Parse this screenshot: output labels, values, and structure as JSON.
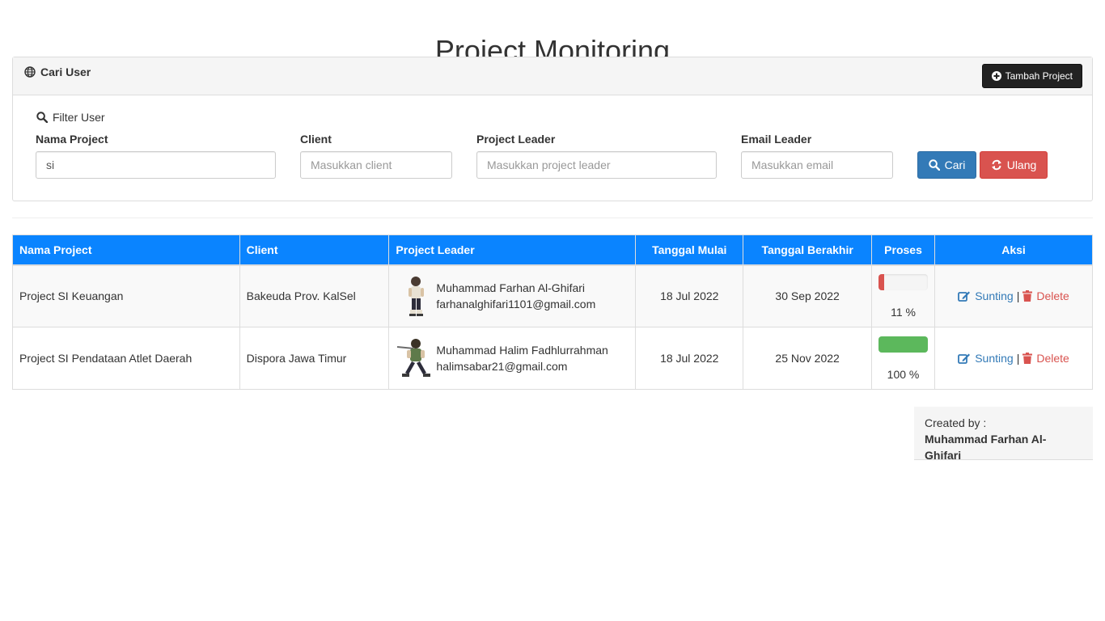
{
  "page": {
    "title": "Project Monitoring"
  },
  "panel": {
    "title": "Cari User",
    "title_icon": "globe-icon",
    "add_button": "Tambah Project",
    "add_button_icon": "plus-circle-icon"
  },
  "filter": {
    "label": "Filter User",
    "label_icon": "search-icon",
    "fields": [
      {
        "label": "Nama Project",
        "value": "si",
        "placeholder": ""
      },
      {
        "label": "Client",
        "value": "",
        "placeholder": "Masukkan client"
      },
      {
        "label": "Project Leader",
        "value": "",
        "placeholder": "Masukkan project leader"
      },
      {
        "label": "Email Leader",
        "value": "",
        "placeholder": "Masukkan email"
      }
    ],
    "search_button": "Cari",
    "reset_button": "Ulang"
  },
  "table": {
    "headers": [
      "Nama Project",
      "Client",
      "Project Leader",
      "Tanggal Mulai",
      "Tanggal Berakhir",
      "Proses",
      "Aksi"
    ],
    "rows": [
      {
        "project": "Project SI Keuangan",
        "client": "Bakeuda Prov. KalSel",
        "leader_name": "Muhammad Farhan Al-Ghifari",
        "leader_email": "farhanalghifari1101@gmail.com",
        "start": "18 Jul 2022",
        "end": "30 Sep 2022",
        "progress": 11,
        "progress_text": "11 %",
        "progress_color": "#d9534f",
        "edit": "Sunting",
        "delete": "Delete"
      },
      {
        "project": "Project SI Pendataan Atlet Daerah",
        "client": "Dispora Jawa Timur",
        "leader_name": "Muhammad Halim Fadhlurrahman",
        "leader_email": "halimsabar21@gmail.com",
        "start": "18 Jul 2022",
        "end": "25 Nov 2022",
        "progress": 100,
        "progress_text": "100 %",
        "progress_color": "#5cb85c",
        "edit": "Sunting",
        "delete": "Delete"
      }
    ],
    "separator": "|"
  },
  "footer": {
    "created_by_label": "Created by :",
    "created_by_name": "Muhammad Farhan Al-Ghifari"
  },
  "colors": {
    "table_header": "#0a84ff",
    "primary": "#337ab7",
    "danger": "#d9534f",
    "success": "#5cb85c"
  }
}
